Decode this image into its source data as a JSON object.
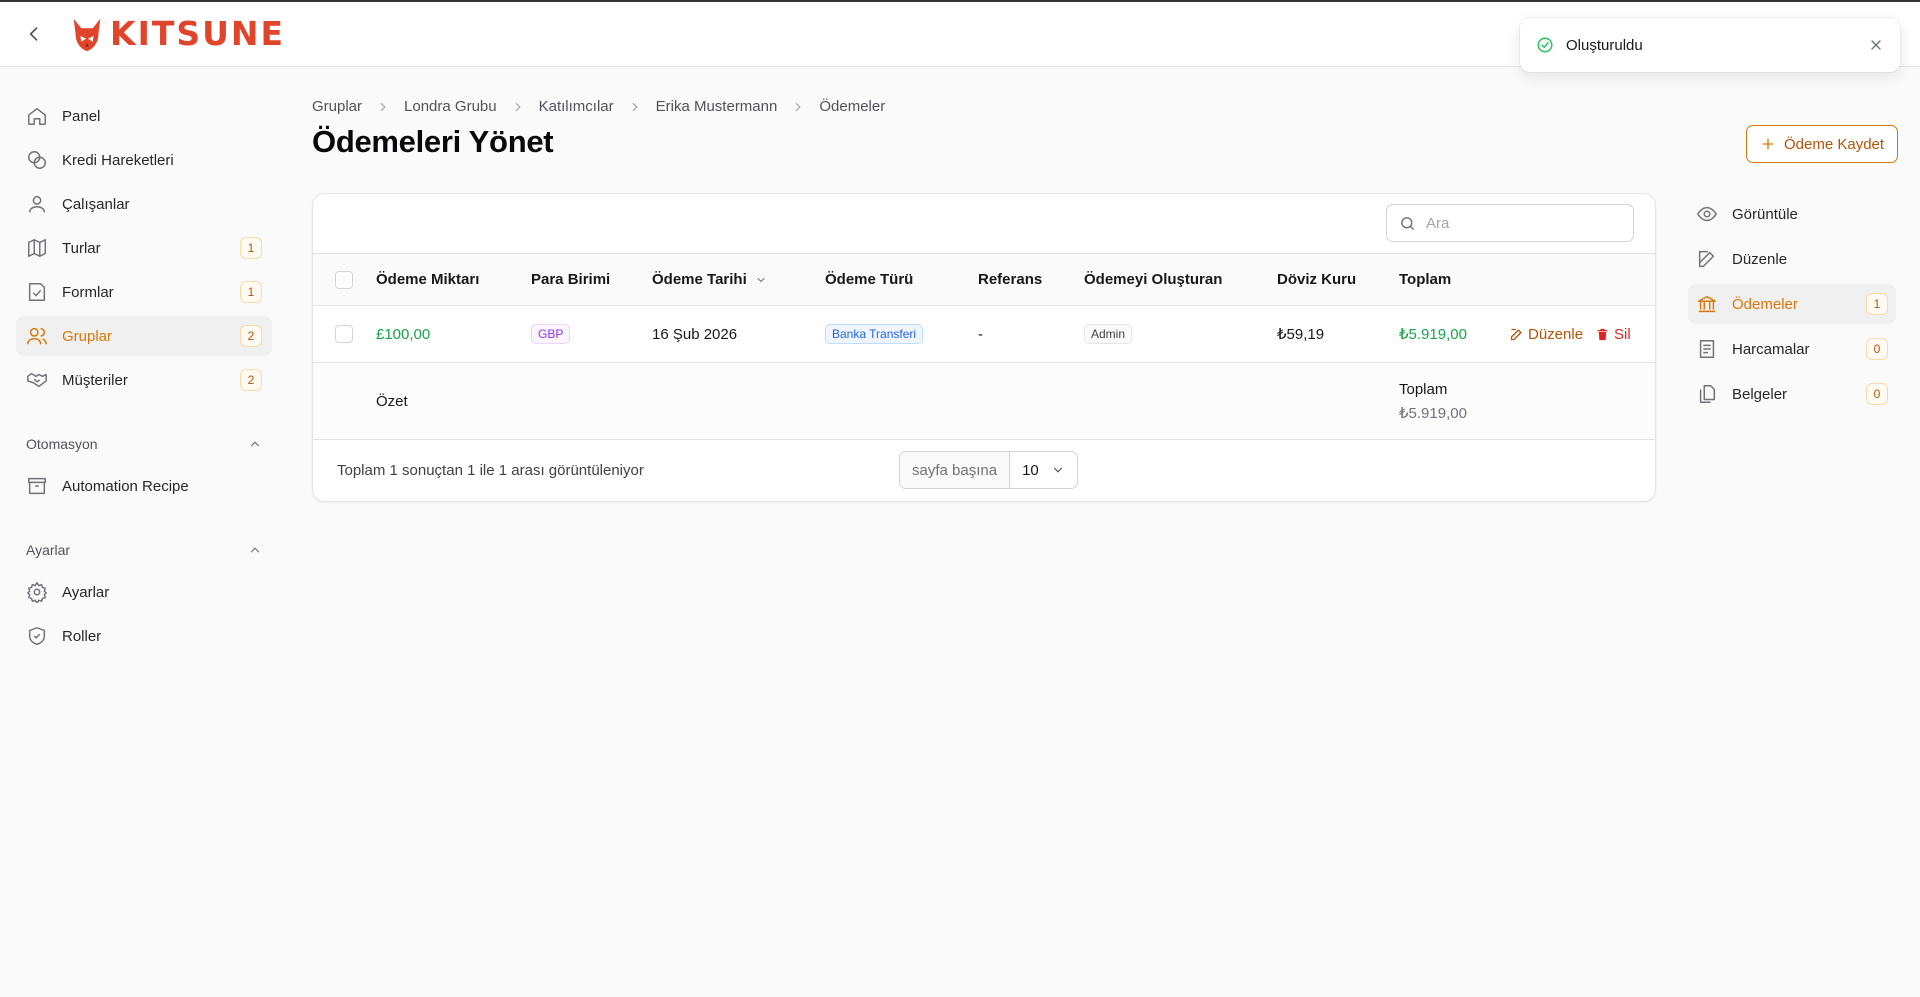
{
  "brand": {
    "name": "KITSUNE"
  },
  "toast": {
    "message": "Oluşturuldu"
  },
  "sidebar": {
    "items": [
      {
        "label": "Panel",
        "icon": "home-icon"
      },
      {
        "label": "Kredi Hareketleri",
        "icon": "coins-icon"
      },
      {
        "label": "Çalışanlar",
        "icon": "user-icon"
      },
      {
        "label": "Turlar",
        "icon": "map-icon",
        "badge": "1"
      },
      {
        "label": "Formlar",
        "icon": "form-icon",
        "badge": "1"
      },
      {
        "label": "Gruplar",
        "icon": "users-icon",
        "badge": "2",
        "active": true
      },
      {
        "label": "Müşteriler",
        "icon": "handshake-icon",
        "badge": "2"
      }
    ],
    "groups": [
      {
        "title": "Otomasyon",
        "items": [
          {
            "label": "Automation Recipe",
            "icon": "box-icon"
          }
        ]
      },
      {
        "title": "Ayarlar",
        "items": [
          {
            "label": "Ayarlar",
            "icon": "gear-icon"
          },
          {
            "label": "Roller",
            "icon": "shield-icon"
          }
        ]
      }
    ]
  },
  "breadcrumb": [
    "Gruplar",
    "Londra Grubu",
    "Katılımcılar",
    "Erika Mustermann",
    "Ödemeler"
  ],
  "page": {
    "title": "Ödemeleri Yönet",
    "primary_action": "Ödeme Kaydet"
  },
  "search": {
    "placeholder": "Ara",
    "value": ""
  },
  "table": {
    "columns": [
      "Ödeme Miktarı",
      "Para Birimi",
      "Ödeme Tarihi",
      "Ödeme Türü",
      "Referans",
      "Ödemeyi Oluşturan",
      "Döviz Kuru",
      "Toplam"
    ],
    "rows": [
      {
        "amount": "£100,00",
        "currency": "GBP",
        "date": "16 Şub 2026",
        "type": "Banka Transferi",
        "reference": "-",
        "creator": "Admin",
        "rate": "₺59,19",
        "total": "₺5.919,00",
        "edit_label": "Düzenle",
        "delete_label": "Sil"
      }
    ],
    "summary": {
      "label": "Özet",
      "total_label": "Toplam",
      "total_value": "₺5.919,00"
    },
    "footer": {
      "info": "Toplam 1 sonuçtan 1 ile 1 arası görüntüleniyor",
      "per_page_label": "sayfa başına",
      "per_page_value": "10"
    }
  },
  "subnav": {
    "items": [
      {
        "label": "Görüntüle",
        "icon": "eye-icon"
      },
      {
        "label": "Düzenle",
        "icon": "edit-icon"
      },
      {
        "label": "Ödemeler",
        "icon": "bank-icon",
        "badge": "1",
        "active": true
      },
      {
        "label": "Harcamalar",
        "icon": "receipt-icon",
        "badge": "0"
      },
      {
        "label": "Belgeler",
        "icon": "documents-icon",
        "badge": "0"
      }
    ]
  },
  "colors": {
    "accent": "#d97706",
    "logo": "#e0442a",
    "success": "#16a34a",
    "danger": "#dc2626"
  }
}
